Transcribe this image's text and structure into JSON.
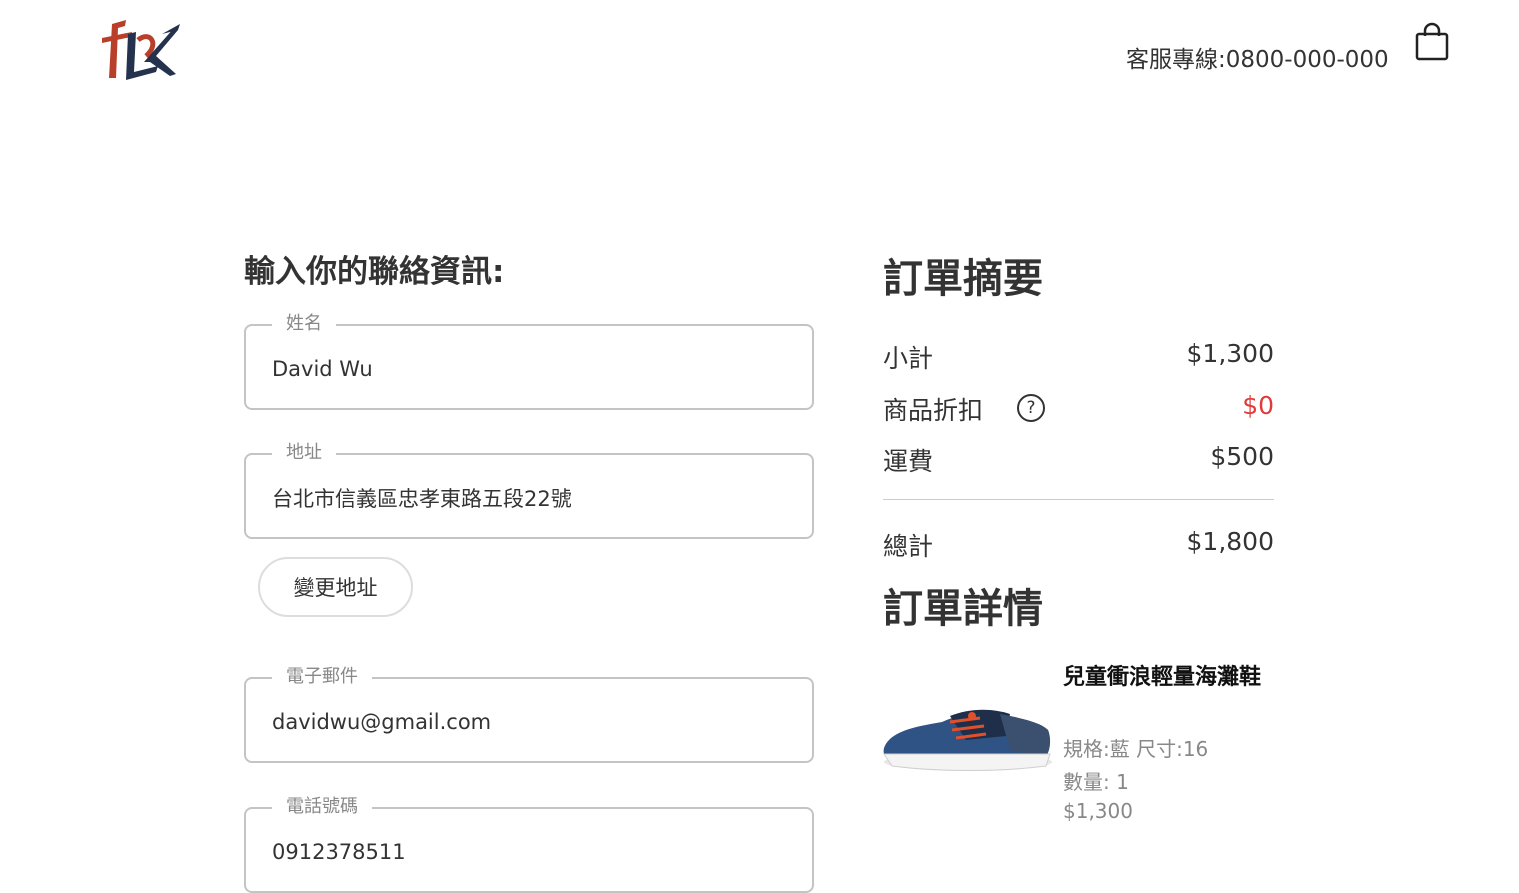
{
  "header": {
    "logo_name": "brand-logo",
    "hotline": "客服專線:0800-000-000",
    "cart_icon": "shopping-bag-icon"
  },
  "contact": {
    "title": "輸入你的聯絡資訊:",
    "fields": {
      "name": {
        "label": "姓名",
        "value": "David Wu"
      },
      "address": {
        "label": "地址",
        "value": "台北市信義區忠孝東路五段22號"
      },
      "email": {
        "label": "電子郵件",
        "value": "davidwu@gmail.com"
      },
      "phone": {
        "label": "電話號碼",
        "value": "0912378511"
      }
    },
    "change_address_label": "變更地址"
  },
  "summary": {
    "title": "訂單摘要",
    "subtotal": {
      "label": "小計",
      "value": "$1,300"
    },
    "discount": {
      "label": "商品折扣",
      "value": "$0",
      "help": "?"
    },
    "shipping": {
      "label": "運費",
      "value": "$500"
    },
    "total": {
      "label": "總計",
      "value": "$1,800"
    }
  },
  "details": {
    "title": "訂單詳情",
    "items": [
      {
        "name": "兒童衝浪輕量海灘鞋",
        "spec": "規格:藍 尺寸:16",
        "qty": "數量: 1",
        "price": "$1,300"
      }
    ]
  },
  "colors": {
    "discount_value": "#e03a3a",
    "text": "#333333",
    "border": "#c4c4c4"
  }
}
